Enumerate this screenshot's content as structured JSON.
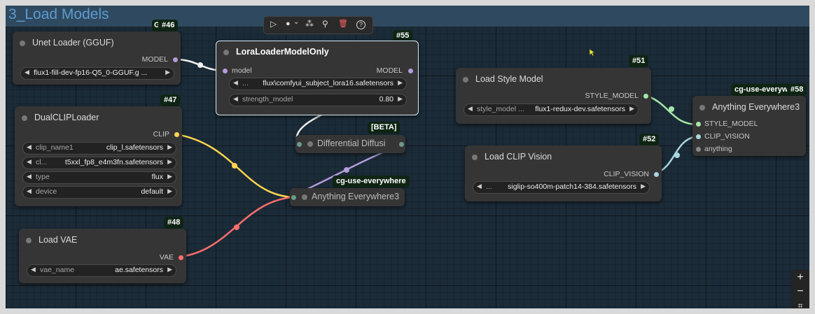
{
  "group": {
    "title": "3_Load Models"
  },
  "toolbar": {
    "play": "▷",
    "circle": "●",
    "chev": "⌄",
    "wand": "⁂",
    "pin": "⚲",
    "trash": "🗑",
    "help": "?"
  },
  "colors": {
    "model": "#b39ddb",
    "clip": "#ffd54f",
    "vae": "#ff6e6e",
    "style": "#a5e6a8",
    "clipvision": "#a6d8e0",
    "badge_bg": "#0f2514"
  },
  "nodes": {
    "unet": {
      "badge": "#46",
      "badge_prefix": "G",
      "title": "Unet Loader (GGUF)",
      "output": "MODEL",
      "widgets": [
        {
          "value": "flux1-fill-dev-fp16-Q5_0-GGUF.g ..."
        }
      ]
    },
    "dualclip": {
      "badge": "#47",
      "title": "DualCLIPLoader",
      "output": "CLIP",
      "widgets": [
        {
          "label": "clip_name1",
          "value": "clip_l.safetensors"
        },
        {
          "label": "cl...",
          "value": "t5xxl_fp8_e4m3fn.safetensors"
        },
        {
          "label": "type",
          "value": "flux"
        },
        {
          "label": "device",
          "value": "default"
        }
      ]
    },
    "vae": {
      "badge": "#48",
      "title": "Load VAE",
      "output": "VAE",
      "widgets": [
        {
          "label": "vae_name",
          "value": "ae.safetensors"
        }
      ]
    },
    "lora": {
      "badge": "#55",
      "title": "LoraLoaderModelOnly",
      "input": "model",
      "output": "MODEL",
      "widgets": [
        {
          "label": "...",
          "value": "flux\\comfyui_subject_lora16.safetensors"
        },
        {
          "label": "strength_model",
          "value": "0.80"
        }
      ]
    },
    "diff": {
      "badge": "[BETA]",
      "title": "Differential Diffusi"
    },
    "anything_mid": {
      "badge": "cg-use-everywhere",
      "title": "Anything Everywhere3"
    },
    "style": {
      "badge": "#51",
      "title": "Load Style Model",
      "output": "STYLE_MODEL",
      "widgets": [
        {
          "label": "style_model ...",
          "value": "flux1-redux-dev.safetensors"
        }
      ]
    },
    "clipvision": {
      "badge": "#52",
      "title": "Load CLIP Vision",
      "output": "CLIP_VISION",
      "widgets": [
        {
          "label": "...",
          "value": "siglip-so400m-patch14-384.safetensors"
        }
      ]
    },
    "anything_right": {
      "badge": "cg-use-everyw",
      "badge2": "#58",
      "title": "Anything Everywhere3",
      "inputs": [
        "STYLE_MODEL",
        "CLIP_VISION",
        "anything"
      ]
    }
  },
  "zoom": {
    "plus": "+",
    "minus": "−",
    "fit": "⌗"
  }
}
